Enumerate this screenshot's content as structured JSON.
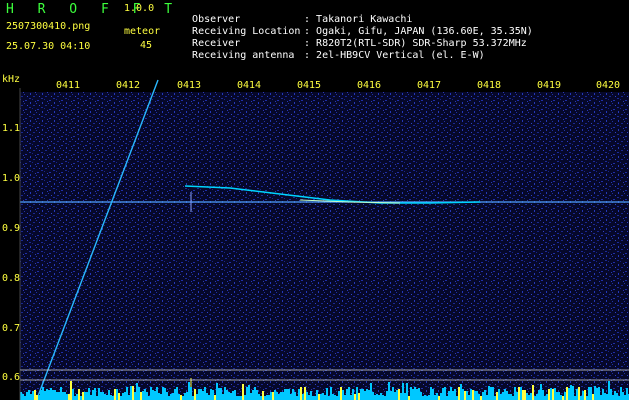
{
  "app": {
    "title": "H R O F F T",
    "version": "1.0.0"
  },
  "file": {
    "name": "2507300410.png"
  },
  "timestamp": "25.07.30 04:10",
  "meteor": {
    "label": "meteor",
    "count": "45"
  },
  "info": [
    {
      "label": "Observer",
      "value": "Takanori Kawachi"
    },
    {
      "label": "Receiving Location",
      "value": "Ogaki, Gifu, JAPAN (136.60E, 35.35N)"
    },
    {
      "label": "Receiver",
      "value": "R820T2(RTL-SDR) SDR-Sharp 53.372MHz"
    },
    {
      "label": "Receiving antenna",
      "value": "2el-HB9CV Vertical (el. E-W)"
    }
  ],
  "axis": {
    "y_unit": "kHz",
    "y_ticks": [
      "1.1",
      "1.0",
      "0.9",
      "0.8",
      "0.7",
      "0.6"
    ],
    "x_ticks": [
      "0411",
      "0412",
      "0413",
      "0414",
      "0415",
      "0416",
      "0417",
      "0418",
      "0419",
      "0420"
    ]
  },
  "colors": {
    "title": "#3cff3c",
    "label": "#ffff40",
    "text": "#ffffff",
    "noise": "#1a2a9a",
    "signal": "#00e0ff",
    "baseline": "#00c8ff"
  }
}
